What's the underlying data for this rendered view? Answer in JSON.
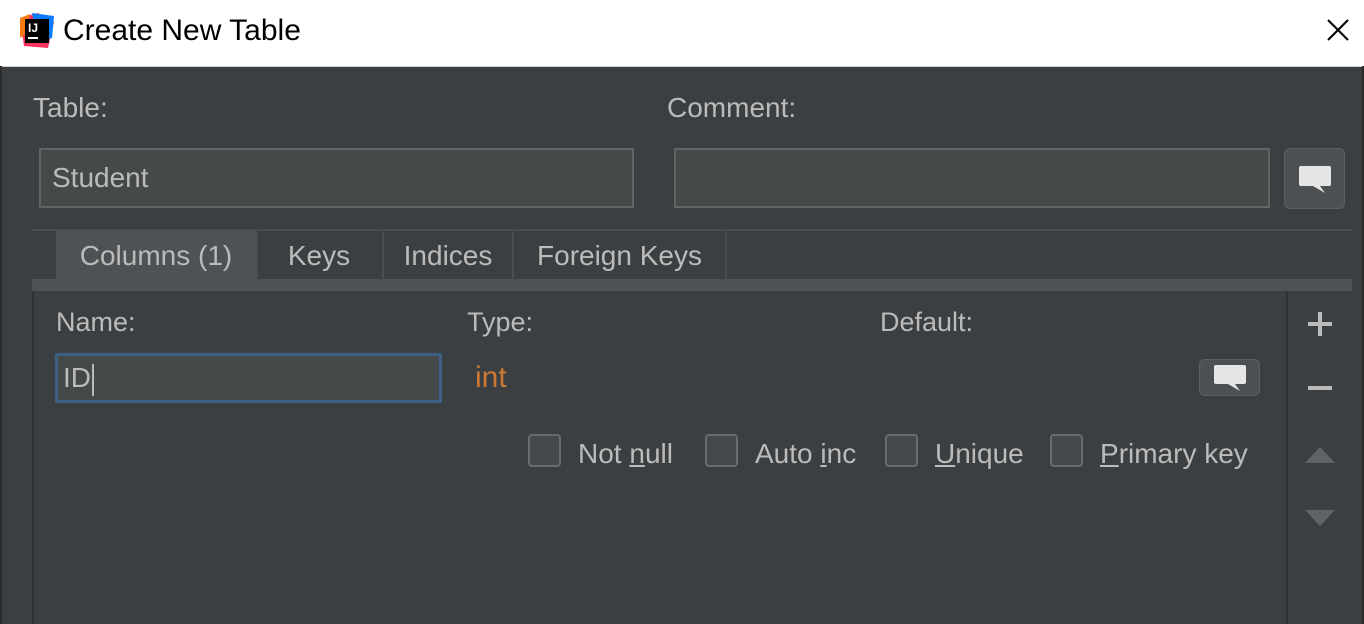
{
  "window": {
    "title": "Create New Table",
    "app_icon": "intellij-idea-icon"
  },
  "table_label": "Table:",
  "table_value": "Student",
  "comment_label": "Comment:",
  "comment_value": "",
  "tabs": [
    {
      "label": "Columns (1)",
      "selected": true
    },
    {
      "label": "Keys",
      "selected": false
    },
    {
      "label": "Indices",
      "selected": false
    },
    {
      "label": "Foreign Keys",
      "selected": false
    }
  ],
  "column": {
    "name_label": "Name:",
    "type_label": "Type:",
    "default_label": "Default:",
    "name_value": "ID",
    "type_value": "int",
    "default_value": ""
  },
  "options": [
    {
      "pre": "Not ",
      "key": "n",
      "post": "ull",
      "checked": false
    },
    {
      "pre": "Auto ",
      "key": "i",
      "post": "nc",
      "checked": false
    },
    {
      "pre": "",
      "key": "U",
      "post": "nique",
      "checked": false
    },
    {
      "pre": "",
      "key": "P",
      "post": "rimary key",
      "checked": false
    }
  ],
  "side_actions": [
    "add-icon",
    "remove-icon",
    "move-up-icon",
    "move-down-icon"
  ],
  "colors": {
    "background": "#3c3f41",
    "text": "#bbbbbb",
    "type_keyword": "#cc7832",
    "focus_border": "#3d6185",
    "titlebar": "#ffffff"
  }
}
